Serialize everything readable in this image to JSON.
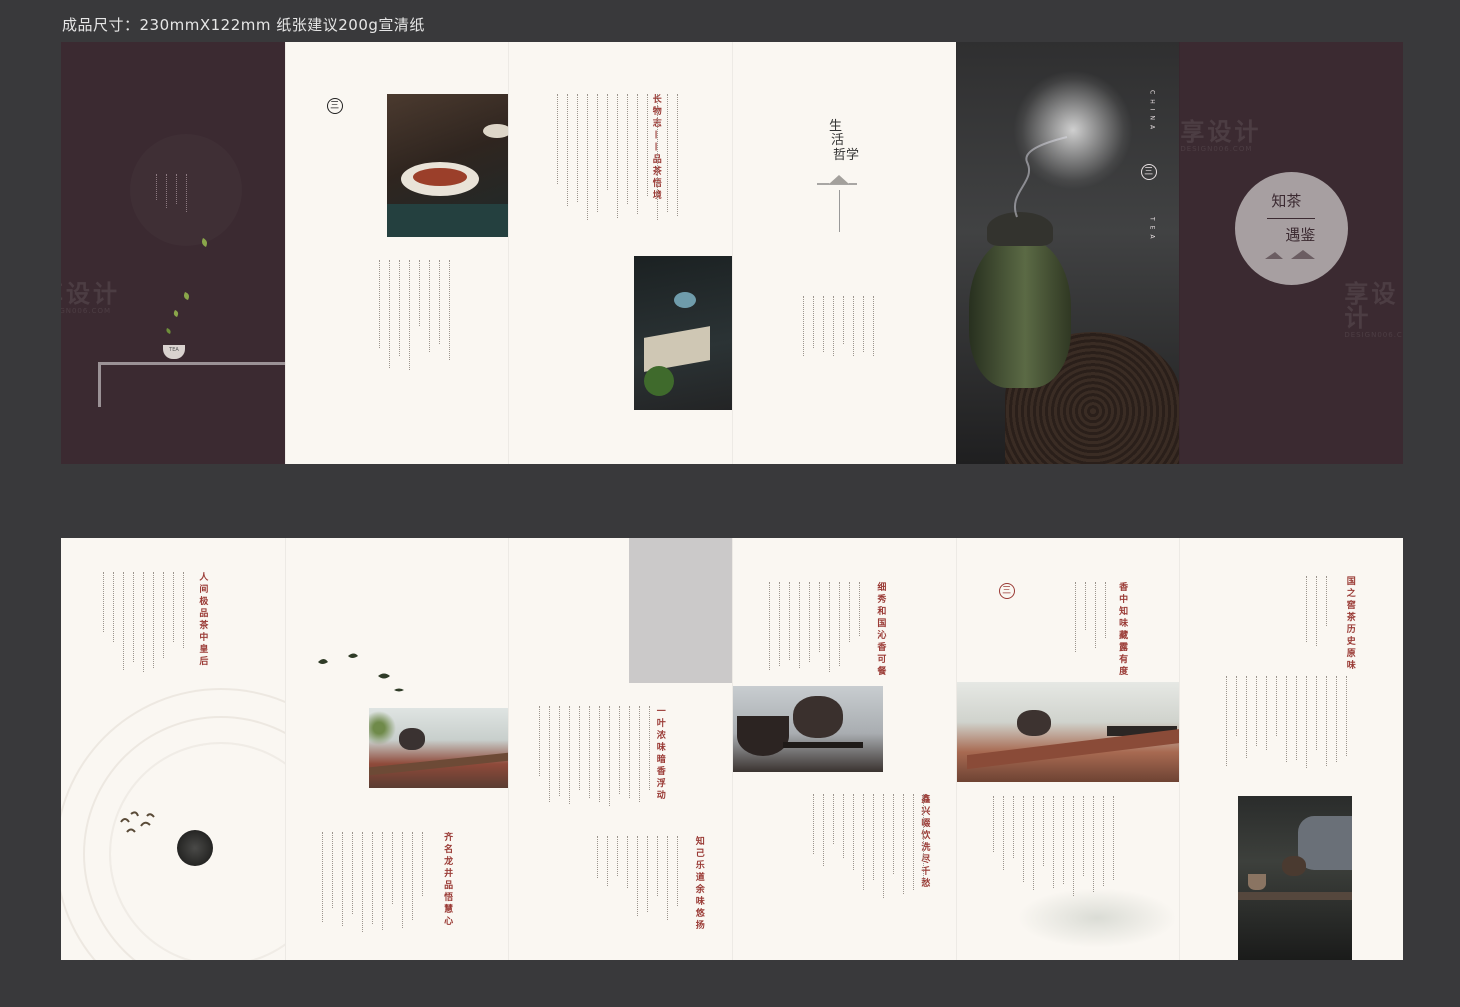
{
  "spec_text": "成品尺寸：230mmX122mm  纸张建议200g宣清纸",
  "colors": {
    "plum": "#3b2a31",
    "cream": "#faf7f2",
    "accent_red": "#9a3b36",
    "background": "#39393b"
  },
  "logo_glyph": "三",
  "top": {
    "p1": {
      "cup_label": "TEA"
    },
    "p3": {
      "title": "长物志——品茶悟境"
    },
    "p4": {
      "title_1": "生",
      "title_2": "活",
      "title_3": "哲学"
    },
    "p5": {
      "china": "CHINA",
      "tea": "TEA"
    },
    "p6": {
      "title_1": "知茶",
      "title_2": "遇鉴"
    }
  },
  "bottom": {
    "p1": {
      "title": "人间极品茶中皇后"
    },
    "p2": {
      "title": "齐名龙井品悟慧心"
    },
    "p3": {
      "title_a": "一叶浓味暗香浮动",
      "title_b": "知己乐道余味悠扬"
    },
    "p4": {
      "title_a": "细秀和国沁香可餐",
      "title_b": "鑫兴啜饮洗尽千愁"
    },
    "p5": {
      "title": "香中知味藏露有度"
    },
    "p6": {
      "title": "国之窖茶历史原味"
    }
  },
  "watermark": {
    "text": "享设计",
    "url": "DESIGN006.COM"
  }
}
